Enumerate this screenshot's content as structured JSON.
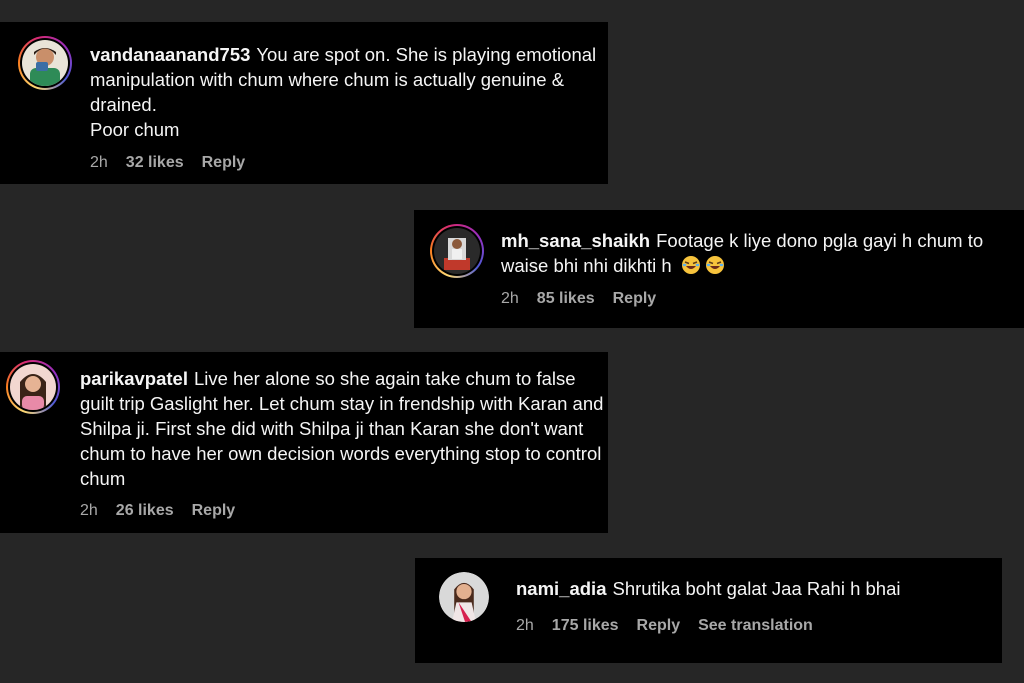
{
  "comments": [
    {
      "username": "vandanaanand753",
      "text": "You are spot on. She is playing emotional manipulation with chum where chum is actually genuine & drained.",
      "text_extra": "Poor chum",
      "time": "2h",
      "likes": "32 likes",
      "reply": "Reply"
    },
    {
      "username": "mh_sana_shaikh",
      "text": "Footage k liye dono pgla gayi h chum to waise bhi nhi dikhti h",
      "emoji": "laughing-emoji",
      "time": "2h",
      "likes": "85 likes",
      "reply": "Reply"
    },
    {
      "username": "parikavpatel",
      "text": "Live her alone so she again take chum to false guilt trip Gaslight her. Let chum stay in frendship with Karan and Shilpa ji. First she did with Shilpa ji than Karan she don't want chum to have her own decision words everything stop to control chum",
      "time": "2h",
      "likes": "26 likes",
      "reply": "Reply"
    },
    {
      "username": "nami_adia",
      "text": "Shrutika boht galat Jaa Rahi h bhai",
      "time": "2h",
      "likes": "175 likes",
      "reply": "Reply",
      "translate": "See translation"
    }
  ],
  "colors": {
    "background": "#262626",
    "card": "#000000",
    "text": "#f5f5f5",
    "meta": "#a8a8a8"
  }
}
